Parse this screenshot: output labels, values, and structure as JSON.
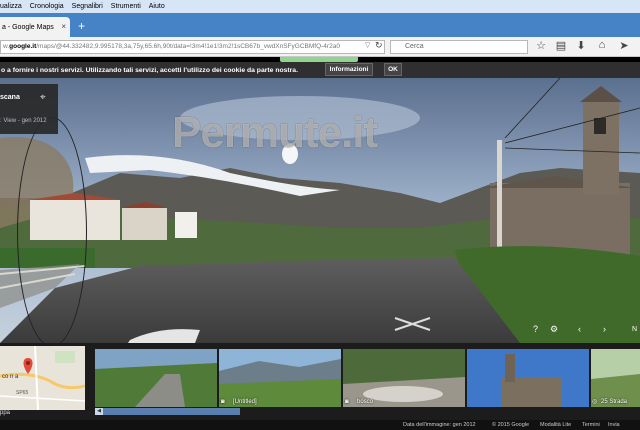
{
  "browser": {
    "menu": [
      "ualizza",
      "Cronologia",
      "Segnalibri",
      "Strumenti",
      "Aiuto"
    ],
    "tab_title": "a - Google Maps",
    "tab_close": "×",
    "new_tab": "+",
    "url_prefix": "w.",
    "url_host": "google.it",
    "url_rest": "/maps/@44.332482,9.995178,3a,75y,65.6h,90t/data=!3m4!1e1!3m2!1sCB67b_vwdXnSFyGCBMfQ-4r2a0",
    "search_placeholder": "Cerca"
  },
  "cookie": {
    "text": "o a fornire i nostri servizi. Utilizzando tali servizi, accetti l'utilizzo dei cookie da parte nostra.",
    "info_label": "Informazioni",
    "ok_label": "OK"
  },
  "streetview": {
    "place": "scana",
    "date": ": View - gen 2012",
    "watermark": "Permute.it",
    "next_label": "N"
  },
  "minimap": {
    "town_label": "co n a",
    "road_label": "SP65",
    "caption": "ppa"
  },
  "thumbnails": [
    {
      "caption": ""
    },
    {
      "caption": "[Untitled]"
    },
    {
      "caption": "bosco"
    },
    {
      "caption": ""
    },
    {
      "caption": "25 Strada"
    }
  ],
  "footer": {
    "date": "Data dell'immagine: gen 2012",
    "copyright": "© 2015 Google",
    "lite": "Modalità Lite",
    "terms": "Termini",
    "report": "Invia feedback"
  },
  "colors": {
    "tabstrip": "#4683c6",
    "menubar": "#d6e6f7",
    "cookiebar": "#2f2f2f"
  }
}
